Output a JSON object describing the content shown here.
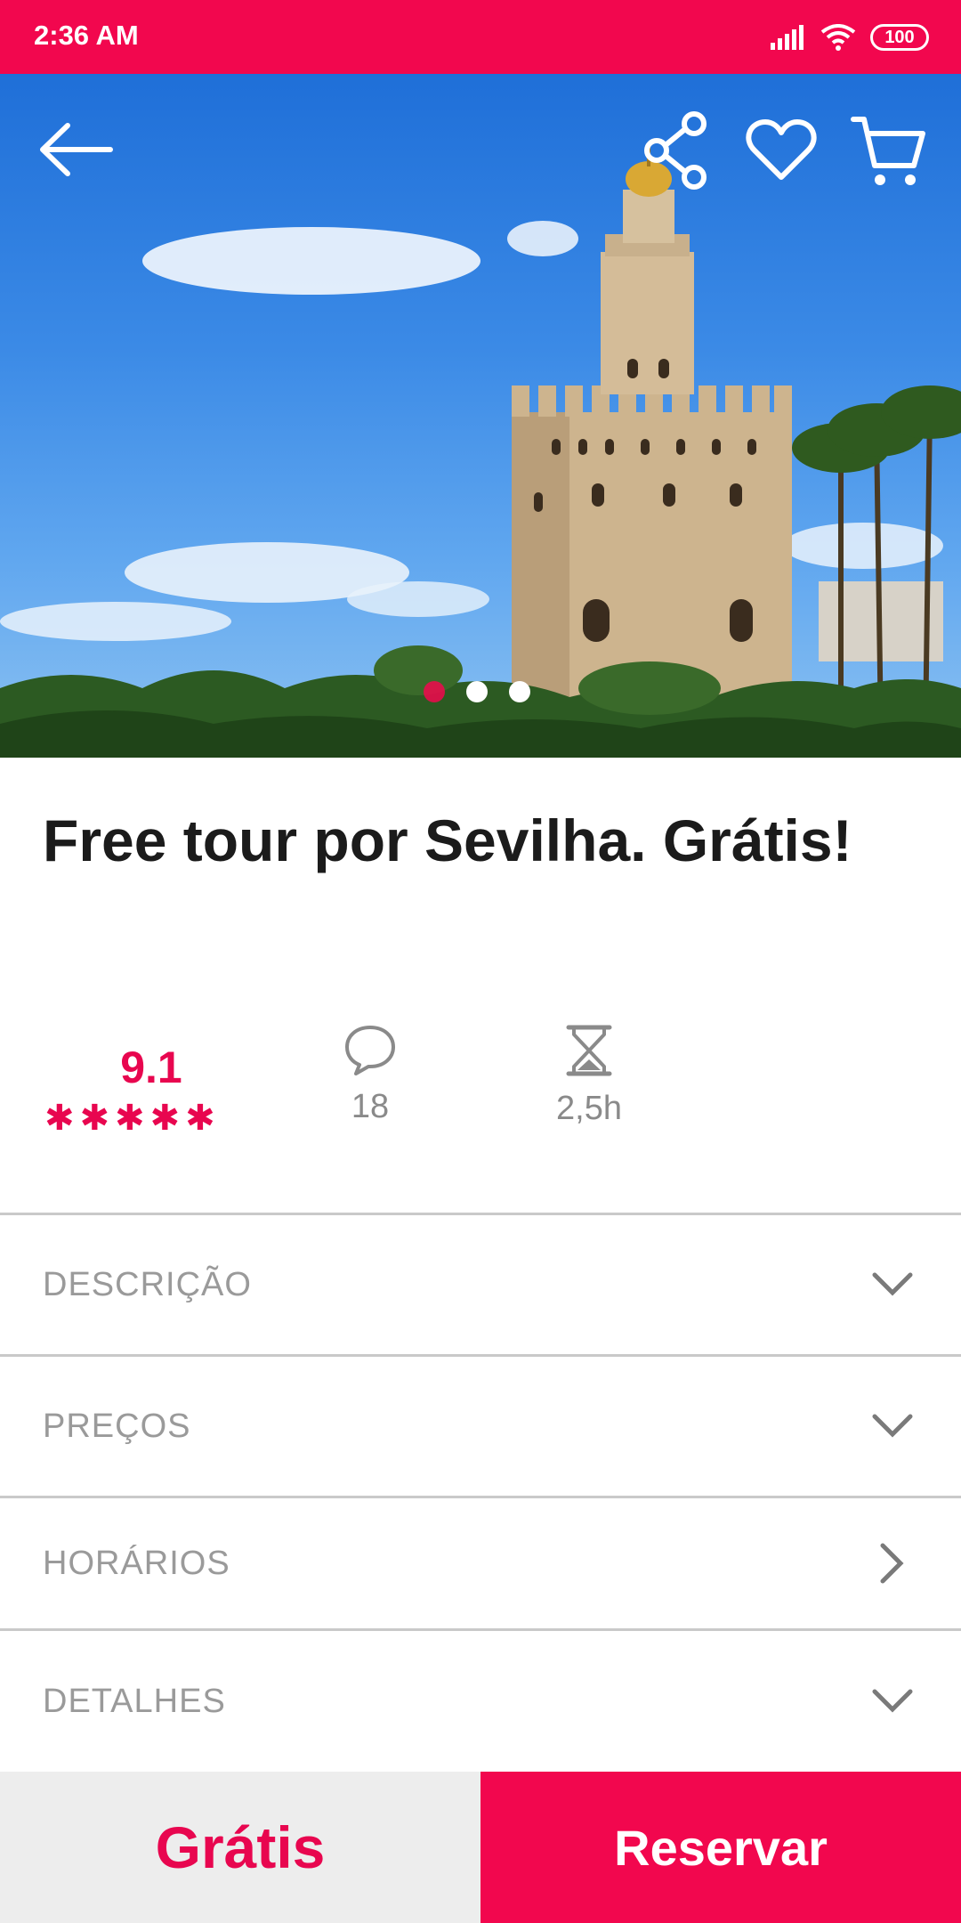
{
  "status_bar": {
    "time": "2:36 AM",
    "battery": "100"
  },
  "hero": {
    "slides_total": 3,
    "active_slide": 1
  },
  "product": {
    "title": "Free tour por Sevilha. Grátis!"
  },
  "stats": {
    "rating": "9.1",
    "stars": 5,
    "reviews": "18",
    "duration": "2,5h"
  },
  "sections": [
    {
      "label": "DESCRIÇÃO",
      "icon": "chevron-down-icon"
    },
    {
      "label": "PREÇOS",
      "icon": "chevron-down-icon"
    },
    {
      "label": "HORÁRIOS",
      "icon": "chevron-right-icon"
    },
    {
      "label": "DETALHES",
      "icon": "chevron-down-icon"
    }
  ],
  "footer": {
    "price": "Grátis",
    "book_label": "Reservar"
  },
  "colors": {
    "brand": "#f2074e",
    "text_muted": "#9a9a9a"
  }
}
